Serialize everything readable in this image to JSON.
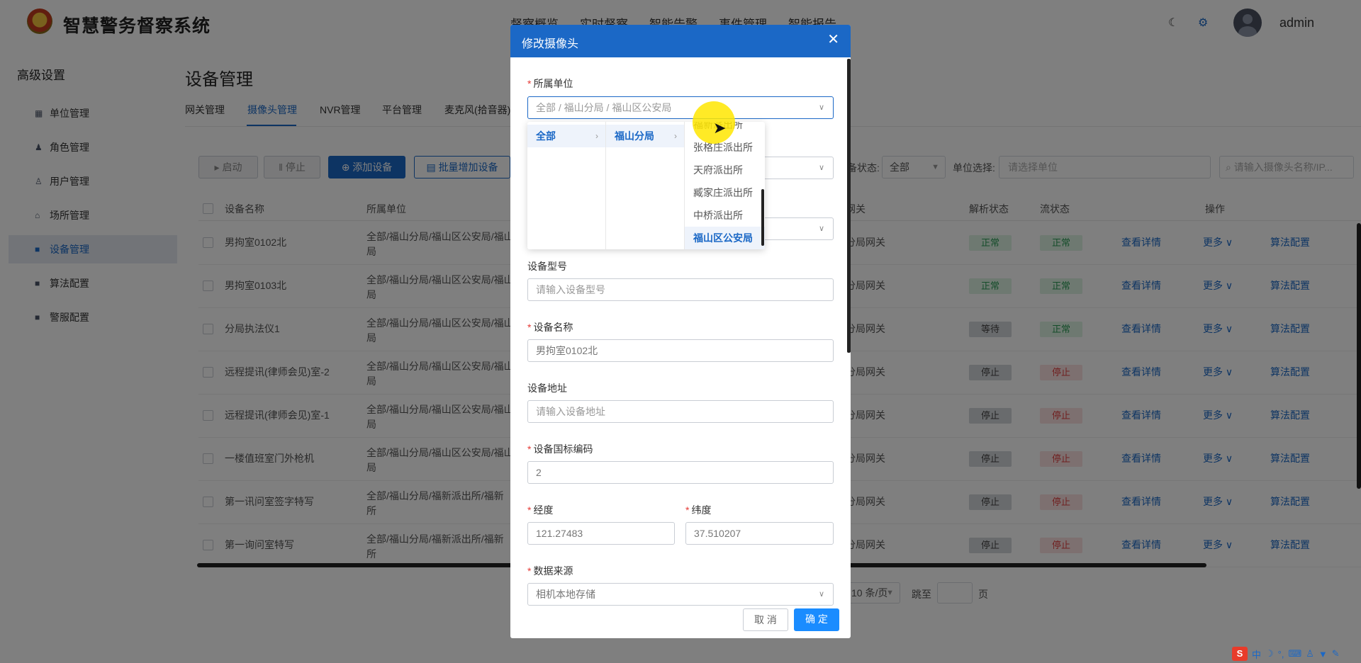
{
  "app": {
    "title": "智慧警务督察系统",
    "nav": [
      "督察概览",
      "实时督察",
      "智能告警",
      "事件管理",
      "智能报告"
    ],
    "username": "admin"
  },
  "sidebar": {
    "title": "高级设置",
    "items": [
      {
        "label": "单位管理",
        "icon": "bank-icon"
      },
      {
        "label": "角色管理",
        "icon": "role-icon"
      },
      {
        "label": "用户管理",
        "icon": "users-icon"
      },
      {
        "label": "场所管理",
        "icon": "home-icon"
      },
      {
        "label": "设备管理",
        "icon": "device-icon",
        "active": true
      },
      {
        "label": "算法配置",
        "icon": "algorithm-icon"
      },
      {
        "label": "警服配置",
        "icon": "uniform-icon"
      }
    ]
  },
  "main": {
    "title": "设备管理",
    "tabs": [
      "网关管理",
      "摄像头管理",
      "NVR管理",
      "平台管理",
      "麦克风(拾音器)"
    ],
    "active_tab": "摄像头管理",
    "toolbar": {
      "start": "启动",
      "stop": "停止",
      "add": "添加设备",
      "batch_add": "批量增加设备",
      "status_label": "备状态:",
      "status_value": "全部",
      "unit_label": "单位选择:",
      "unit_placeholder": "请选择单位",
      "search_placeholder": "请输入摄像头名称/IP..."
    },
    "table": {
      "headers": [
        "设备名称",
        "所属单位",
        "网关",
        "解析状态",
        "流状态",
        "操作"
      ],
      "actions": {
        "detail": "查看详情",
        "more": "更多",
        "algo": "算法配置"
      },
      "rows": [
        {
          "name": "男拘室0102北",
          "unit1": "全部/福山分局/福山区公安局/福山",
          "unit2": "局",
          "gateway": "分局网关",
          "parse": "正常",
          "parse_kind": "green",
          "stream": "正常",
          "stream_kind": "green"
        },
        {
          "name": "男拘室0103北",
          "unit1": "全部/福山分局/福山区公安局/福山",
          "unit2": "局",
          "gateway": "分局网关",
          "parse": "正常",
          "parse_kind": "green",
          "stream": "正常",
          "stream_kind": "green"
        },
        {
          "name": "分局执法仪1",
          "unit1": "全部/福山分局/福山区公安局/福山",
          "unit2": "局",
          "gateway": "分局网关",
          "parse": "等待",
          "parse_kind": "gray",
          "stream": "正常",
          "stream_kind": "green"
        },
        {
          "name": "远程提讯(律师会见)室-2",
          "unit1": "全部/福山分局/福山区公安局/福山",
          "unit2": "局",
          "gateway": "分局网关",
          "parse": "停止",
          "parse_kind": "gray",
          "stream": "停止",
          "stream_kind": "red"
        },
        {
          "name": "远程提讯(律师会见)室-1",
          "unit1": "全部/福山分局/福山区公安局/福山",
          "unit2": "局",
          "gateway": "分局网关",
          "parse": "停止",
          "parse_kind": "gray",
          "stream": "停止",
          "stream_kind": "red"
        },
        {
          "name": "一楼值班室门外枪机",
          "unit1": "全部/福山分局/福山区公安局/福山",
          "unit2": "局",
          "gateway": "分局网关",
          "parse": "停止",
          "parse_kind": "gray",
          "stream": "停止",
          "stream_kind": "red"
        },
        {
          "name": "第一讯问室签字特写",
          "unit1": "全部/福山分局/福新派出所/福新",
          "unit2": "所",
          "gateway": "分局网关",
          "parse": "停止",
          "parse_kind": "gray",
          "stream": "停止",
          "stream_kind": "red"
        },
        {
          "name": "第一询问室特写",
          "unit1": "全部/福山分局/福新派出所/福新",
          "unit2": "所",
          "gateway": "分局网关",
          "parse": "停止",
          "parse_kind": "gray",
          "stream": "停止",
          "stream_kind": "red"
        }
      ]
    },
    "pagination": {
      "page_size": "10 条/页",
      "goto": "跳至",
      "page": "页"
    }
  },
  "modal": {
    "title": "修改摄像头",
    "fields": {
      "unit_label": "所属单位",
      "unit_value": "全部 / 福山分局 / 福山区公安局",
      "model_label": "设备型号",
      "model_placeholder": "请输入设备型号",
      "name_label": "设备名称",
      "name_value": "男拘室0102北",
      "address_label": "设备地址",
      "address_placeholder": "请输入设备地址",
      "gb_label": "设备国标编码",
      "gb_value": "2",
      "lng_label": "经度",
      "lng_value": "121.27483",
      "lat_label": "纬度",
      "lat_value": "37.510207",
      "source_label": "数据来源",
      "source_value": "相机本地存储"
    },
    "cancel": "取 消",
    "confirm": "确 定"
  },
  "cascader": {
    "col1": [
      "全部"
    ],
    "col2": [
      "福山分局"
    ],
    "col3": [
      "福新派出所",
      "张格庄派出所",
      "天府派出所",
      "臧家庄派出所",
      "中桥派出所",
      "福山区公安局"
    ]
  },
  "tray": {
    "ime": "中",
    "items": [
      "中",
      "°,",
      "⌨"
    ]
  }
}
